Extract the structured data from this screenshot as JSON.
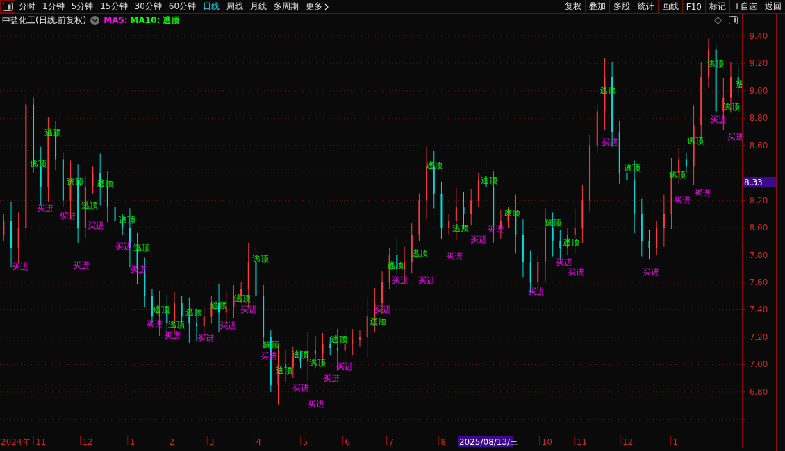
{
  "toolbar": {
    "periods": [
      {
        "label": "分时",
        "selected": false
      },
      {
        "label": "1分钟",
        "selected": false
      },
      {
        "label": "5分钟",
        "selected": false
      },
      {
        "label": "15分钟",
        "selected": false
      },
      {
        "label": "30分钟",
        "selected": false
      },
      {
        "label": "60分钟",
        "selected": false
      },
      {
        "label": "日线",
        "selected": true
      },
      {
        "label": "周线",
        "selected": false
      },
      {
        "label": "月线",
        "selected": false
      },
      {
        "label": "多周期",
        "selected": false
      }
    ],
    "more": "更多",
    "actions": [
      "复权",
      "叠加",
      "多股",
      "统计",
      "画线",
      "F10",
      "标记",
      "+自选",
      "返回"
    ]
  },
  "header": {
    "title": "中盐化工(日线.前复权)",
    "indicators": [
      {
        "label": "MA5:",
        "color": "#ff00ff"
      },
      {
        "label": "MA10:",
        "color": "#00ff00"
      },
      {
        "label": "逃顶",
        "color": "#00ff00"
      }
    ]
  },
  "chart": {
    "price_axis": [
      "9.40",
      "9.20",
      "9.00",
      "8.80",
      "8.60",
      "8.20",
      "8.00",
      "7.80",
      "7.60",
      "7.40",
      "7.20",
      "7.00",
      "6.80"
    ],
    "current_price": "8.33",
    "date_axis": [
      "2024年",
      "11",
      "12",
      "1",
      "2",
      "3",
      "4",
      "5",
      "6",
      "7",
      "8",
      "10",
      "11",
      "12",
      "1"
    ],
    "cursor_date": "2025/08/13/三",
    "signals": [
      {
        "kind": "sell",
        "text": "逃顶"
      },
      {
        "kind": "sell",
        "text": "逃顶"
      },
      {
        "kind": "sell",
        "text": "逃顶"
      },
      {
        "kind": "sell",
        "text": "逃顶"
      },
      {
        "kind": "sell",
        "text": "逃顶"
      },
      {
        "kind": "sell",
        "text": "逃顶"
      },
      {
        "kind": "sell",
        "text": "逃顶"
      },
      {
        "kind": "sell",
        "text": "逃顶"
      },
      {
        "kind": "sell",
        "text": "逃顶"
      },
      {
        "kind": "sell",
        "text": "逃顶"
      },
      {
        "kind": "sell",
        "text": "逃顶"
      },
      {
        "kind": "sell",
        "text": "逃顶"
      },
      {
        "kind": "sell",
        "text": "逃顶"
      },
      {
        "kind": "sell",
        "text": "逃顶"
      },
      {
        "kind": "sell",
        "text": "逃顶"
      },
      {
        "kind": "sell",
        "text": "逃顶"
      },
      {
        "kind": "sell",
        "text": "逃顶"
      },
      {
        "kind": "sell",
        "text": "逃顶"
      },
      {
        "kind": "sell",
        "text": "逃顶"
      },
      {
        "kind": "sell",
        "text": "逃顶"
      },
      {
        "kind": "sell",
        "text": "逃顶"
      },
      {
        "kind": "sell",
        "text": "逃顶"
      },
      {
        "kind": "sell",
        "text": "逃顶"
      },
      {
        "kind": "sell",
        "text": "逃顶"
      },
      {
        "kind": "sell",
        "text": "逃顶"
      },
      {
        "kind": "sell",
        "text": "逃顶"
      },
      {
        "kind": "sell",
        "text": "逃顶"
      },
      {
        "kind": "sell",
        "text": "逃顶"
      },
      {
        "kind": "sell",
        "text": "逃顶"
      },
      {
        "kind": "sell",
        "text": "逃顶"
      },
      {
        "kind": "sell",
        "text": "逃顶"
      },
      {
        "kind": "sell",
        "text": "逃顶"
      },
      {
        "kind": "sell",
        "text": "逃顶"
      },
      {
        "kind": "sell",
        "text": "逃"
      },
      {
        "kind": "buy",
        "text": "买进"
      },
      {
        "kind": "buy",
        "text": "买进"
      },
      {
        "kind": "buy",
        "text": "买进"
      },
      {
        "kind": "buy",
        "text": "买进"
      },
      {
        "kind": "buy",
        "text": "买进"
      },
      {
        "kind": "buy",
        "text": "买进"
      },
      {
        "kind": "buy",
        "text": "买进"
      },
      {
        "kind": "buy",
        "text": "买进"
      },
      {
        "kind": "buy",
        "text": "买进"
      },
      {
        "kind": "buy",
        "text": "买进"
      },
      {
        "kind": "buy",
        "text": "买进"
      },
      {
        "kind": "buy",
        "text": "买进"
      },
      {
        "kind": "buy",
        "text": "买进"
      },
      {
        "kind": "buy",
        "text": "买进"
      },
      {
        "kind": "buy",
        "text": "买进"
      },
      {
        "kind": "buy",
        "text": "买进"
      },
      {
        "kind": "buy",
        "text": "买进"
      },
      {
        "kind": "buy",
        "text": "买进"
      },
      {
        "kind": "buy",
        "text": "买进"
      },
      {
        "kind": "buy",
        "text": "买进"
      },
      {
        "kind": "buy",
        "text": "买进"
      },
      {
        "kind": "buy",
        "text": "买进"
      },
      {
        "kind": "buy",
        "text": "买进"
      },
      {
        "kind": "buy",
        "text": "买进"
      },
      {
        "kind": "buy",
        "text": "买进"
      },
      {
        "kind": "buy",
        "text": "买进"
      },
      {
        "kind": "buy",
        "text": "买进"
      },
      {
        "kind": "buy",
        "text": "买进"
      },
      {
        "kind": "buy",
        "text": "买进"
      },
      {
        "kind": "buy",
        "text": "买进"
      },
      {
        "kind": "buy",
        "text": "买进"
      },
      {
        "kind": "buy",
        "text": "买进"
      }
    ]
  }
}
